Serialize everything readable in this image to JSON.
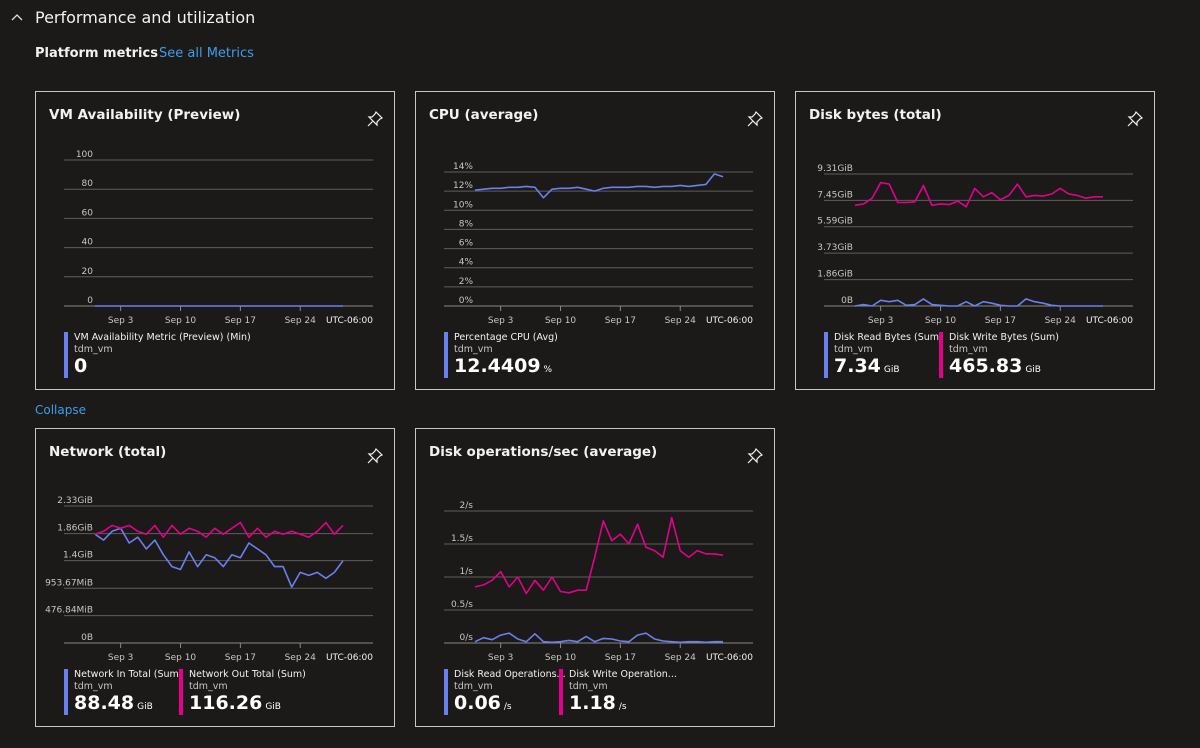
{
  "section": {
    "title": "Performance and utilization",
    "expanded": true
  },
  "platform_metrics_label": "Platform metrics",
  "see_all_link": "See all Metrics",
  "collapse_link": "Collapse",
  "colors": {
    "blue": "#6a7ff0",
    "magenta": "#e3008c",
    "link": "#3a9eea"
  },
  "chart_data": [
    {
      "type": "line",
      "title": "VM Availability (Preview)",
      "timezone": "UTC-06:00",
      "xticks": [
        "Sep 3",
        "Sep 10",
        "Sep 17",
        "Sep 24"
      ],
      "yticks": [
        "0",
        "20",
        "40",
        "60",
        "80",
        "100"
      ],
      "ytick_values": [
        0,
        20,
        40,
        60,
        80,
        100
      ],
      "ylim": [
        0,
        100
      ],
      "grid": true,
      "x": [
        "Aug 31",
        "Sep 1",
        "Sep 2",
        "Sep 3",
        "Sep 4",
        "Sep 5",
        "Sep 6",
        "Sep 7",
        "Sep 8",
        "Sep 9",
        "Sep 10",
        "Sep 11",
        "Sep 12",
        "Sep 13",
        "Sep 14",
        "Sep 15",
        "Sep 16",
        "Sep 17",
        "Sep 18",
        "Sep 19",
        "Sep 20",
        "Sep 21",
        "Sep 22",
        "Sep 23",
        "Sep 24",
        "Sep 25",
        "Sep 26",
        "Sep 27",
        "Sep 28",
        "Sep 29"
      ],
      "series": [
        {
          "name": "VM Availability Metric (Preview) (Min)",
          "resource": "tdm_vm",
          "color": "#6a7ff0",
          "summary": "0",
          "unit": "",
          "values": [
            0,
            0,
            0,
            0,
            0,
            0,
            0,
            0,
            0,
            0,
            0,
            0,
            0,
            0,
            0,
            0,
            0,
            0,
            0,
            0,
            0,
            0,
            0,
            0,
            0,
            0,
            0,
            0,
            0,
            0
          ]
        }
      ]
    },
    {
      "type": "line",
      "title": "CPU (average)",
      "timezone": "UTC-06:00",
      "xticks": [
        "Sep 3",
        "Sep 10",
        "Sep 17",
        "Sep 24"
      ],
      "yticks": [
        "0%",
        "2%",
        "4%",
        "6%",
        "8%",
        "10%",
        "12%",
        "14%"
      ],
      "ytick_values": [
        0,
        2,
        4,
        6,
        8,
        10,
        12,
        14
      ],
      "ylim": [
        0,
        14
      ],
      "grid": true,
      "x": [
        "Aug 31",
        "Sep 1",
        "Sep 2",
        "Sep 3",
        "Sep 4",
        "Sep 5",
        "Sep 6",
        "Sep 7",
        "Sep 8",
        "Sep 9",
        "Sep 10",
        "Sep 11",
        "Sep 12",
        "Sep 13",
        "Sep 14",
        "Sep 15",
        "Sep 16",
        "Sep 17",
        "Sep 18",
        "Sep 19",
        "Sep 20",
        "Sep 21",
        "Sep 22",
        "Sep 23",
        "Sep 24",
        "Sep 25",
        "Sep 26",
        "Sep 27",
        "Sep 28",
        "Sep 29"
      ],
      "series": [
        {
          "name": "Percentage CPU (Avg)",
          "resource": "tdm_vm",
          "color": "#6a7ff0",
          "summary": "12.4409",
          "unit": "%",
          "values": [
            12.1,
            12.2,
            12.3,
            12.3,
            12.4,
            12.4,
            12.5,
            12.4,
            11.3,
            12.2,
            12.3,
            12.3,
            12.4,
            12.2,
            12.0,
            12.3,
            12.4,
            12.4,
            12.4,
            12.5,
            12.5,
            12.4,
            12.5,
            12.5,
            12.6,
            12.5,
            12.6,
            12.7,
            13.8,
            13.5
          ]
        }
      ]
    },
    {
      "type": "line",
      "title": "Disk bytes (total)",
      "timezone": "UTC-06:00",
      "xticks": [
        "Sep 3",
        "Sep 10",
        "Sep 17",
        "Sep 24"
      ],
      "yticks": [
        "0B",
        "1.86GiB",
        "3.73GiB",
        "5.59GiB",
        "7.45GiB",
        "9.31GiB"
      ],
      "ytick_values": [
        0,
        1.86,
        3.73,
        5.59,
        7.45,
        9.31
      ],
      "ylim": [
        0,
        9.31
      ],
      "grid": true,
      "x": [
        "Aug 31",
        "Sep 1",
        "Sep 2",
        "Sep 3",
        "Sep 4",
        "Sep 5",
        "Sep 6",
        "Sep 7",
        "Sep 8",
        "Sep 9",
        "Sep 10",
        "Sep 11",
        "Sep 12",
        "Sep 13",
        "Sep 14",
        "Sep 15",
        "Sep 16",
        "Sep 17",
        "Sep 18",
        "Sep 19",
        "Sep 20",
        "Sep 21",
        "Sep 22",
        "Sep 23",
        "Sep 24",
        "Sep 25",
        "Sep 26",
        "Sep 27",
        "Sep 28",
        "Sep 29"
      ],
      "series": [
        {
          "name": "Disk Read Bytes (Sum)",
          "resource": "tdm_vm",
          "color": "#6a7ff0",
          "summary": "7.34",
          "unit": "GiB",
          "values": [
            0,
            0.1,
            0,
            0.4,
            0.3,
            0.4,
            0.05,
            0.1,
            0.5,
            0.1,
            0.05,
            0,
            0,
            0.3,
            0,
            0.3,
            0.2,
            0.05,
            0,
            0,
            0.5,
            0.3,
            0.2,
            0.05,
            0,
            0,
            0,
            0,
            0,
            0
          ]
        },
        {
          "name": "Disk Write Bytes (Sum)",
          "resource": "tdm_vm",
          "color": "#e3008c",
          "summary": "465.83",
          "unit": "GiB",
          "values": [
            7.1,
            7.2,
            7.6,
            8.7,
            8.6,
            7.3,
            7.3,
            7.35,
            8.5,
            7.1,
            7.2,
            7.15,
            7.4,
            7.0,
            8.3,
            7.7,
            8.0,
            7.5,
            7.8,
            8.6,
            7.7,
            7.8,
            7.75,
            7.9,
            8.3,
            7.9,
            7.8,
            7.6,
            7.7,
            7.7
          ]
        }
      ]
    },
    {
      "type": "line",
      "title": "Network (total)",
      "timezone": "UTC-06:00",
      "xticks": [
        "Sep 3",
        "Sep 10",
        "Sep 17",
        "Sep 24"
      ],
      "yticks": [
        "0B",
        "476.84MiB",
        "953.67MiB",
        "1.4GiB",
        "1.86GiB",
        "2.33GiB"
      ],
      "ytick_values": [
        0,
        0.466,
        0.931,
        1.4,
        1.86,
        2.33
      ],
      "ylim": [
        0,
        2.33
      ],
      "grid": true,
      "x": [
        "Aug 31",
        "Sep 1",
        "Sep 2",
        "Sep 3",
        "Sep 4",
        "Sep 5",
        "Sep 6",
        "Sep 7",
        "Sep 8",
        "Sep 9",
        "Sep 10",
        "Sep 11",
        "Sep 12",
        "Sep 13",
        "Sep 14",
        "Sep 15",
        "Sep 16",
        "Sep 17",
        "Sep 18",
        "Sep 19",
        "Sep 20",
        "Sep 21",
        "Sep 22",
        "Sep 23",
        "Sep 24",
        "Sep 25",
        "Sep 26",
        "Sep 27",
        "Sep 28",
        "Sep 29"
      ],
      "series": [
        {
          "name": "Network In Total (Sum)",
          "resource": "tdm_vm",
          "color": "#6a7ff0",
          "summary": "88.48",
          "unit": "GiB",
          "values": [
            1.85,
            1.75,
            1.9,
            1.95,
            1.7,
            1.8,
            1.6,
            1.75,
            1.5,
            1.3,
            1.25,
            1.55,
            1.3,
            1.5,
            1.45,
            1.3,
            1.5,
            1.45,
            1.7,
            1.6,
            1.5,
            1.3,
            1.3,
            0.95,
            1.2,
            1.15,
            1.2,
            1.1,
            1.2,
            1.4
          ]
        },
        {
          "name": "Network Out Total (Sum)",
          "resource": "tdm_vm",
          "color": "#e3008c",
          "summary": "116.26",
          "unit": "GiB",
          "values": [
            1.85,
            1.9,
            2.0,
            1.95,
            2.0,
            1.9,
            1.85,
            2.0,
            1.8,
            2.0,
            1.85,
            1.95,
            1.9,
            1.8,
            1.95,
            1.85,
            1.95,
            2.05,
            1.8,
            1.95,
            1.8,
            1.9,
            1.85,
            1.9,
            1.85,
            1.8,
            1.9,
            2.05,
            1.85,
            2.0
          ]
        }
      ]
    },
    {
      "type": "line",
      "title": "Disk operations/sec (average)",
      "timezone": "UTC-06:00",
      "xticks": [
        "Sep 3",
        "Sep 10",
        "Sep 17",
        "Sep 24"
      ],
      "yticks": [
        "0/s",
        "0.5/s",
        "1/s",
        "1.5/s",
        "2/s"
      ],
      "ytick_values": [
        0,
        0.5,
        1,
        1.5,
        2
      ],
      "ylim": [
        0,
        2
      ],
      "grid": true,
      "x": [
        "Aug 31",
        "Sep 1",
        "Sep 2",
        "Sep 3",
        "Sep 4",
        "Sep 5",
        "Sep 6",
        "Sep 7",
        "Sep 8",
        "Sep 9",
        "Sep 10",
        "Sep 11",
        "Sep 12",
        "Sep 13",
        "Sep 14",
        "Sep 15",
        "Sep 16",
        "Sep 17",
        "Sep 18",
        "Sep 19",
        "Sep 20",
        "Sep 21",
        "Sep 22",
        "Sep 23",
        "Sep 24",
        "Sep 25",
        "Sep 26",
        "Sep 27",
        "Sep 28",
        "Sep 29"
      ],
      "series": [
        {
          "name": "Disk Read Operations...",
          "resource": "tdm_vm",
          "color": "#6a7ff0",
          "summary": "0.06",
          "unit": "/s",
          "values": [
            0.02,
            0.08,
            0.05,
            0.12,
            0.15,
            0.06,
            0.02,
            0.14,
            0.02,
            0.01,
            0.02,
            0.04,
            0.02,
            0.1,
            0.02,
            0.07,
            0.06,
            0.03,
            0.02,
            0.12,
            0.15,
            0.06,
            0.03,
            0.02,
            0.01,
            0.02,
            0.02,
            0.01,
            0.02,
            0.02
          ]
        },
        {
          "name": "Disk Write Operation...",
          "resource": "tdm_vm",
          "color": "#e3008c",
          "summary": "1.18",
          "unit": "/s",
          "values": [
            0.85,
            0.88,
            0.95,
            1.08,
            0.85,
            1.0,
            0.75,
            0.95,
            0.8,
            1.0,
            0.78,
            0.76,
            0.8,
            0.8,
            1.3,
            1.85,
            1.55,
            1.65,
            1.5,
            1.8,
            1.45,
            1.4,
            1.3,
            1.9,
            1.4,
            1.3,
            1.4,
            1.35,
            1.35,
            1.33
          ]
        }
      ]
    }
  ]
}
